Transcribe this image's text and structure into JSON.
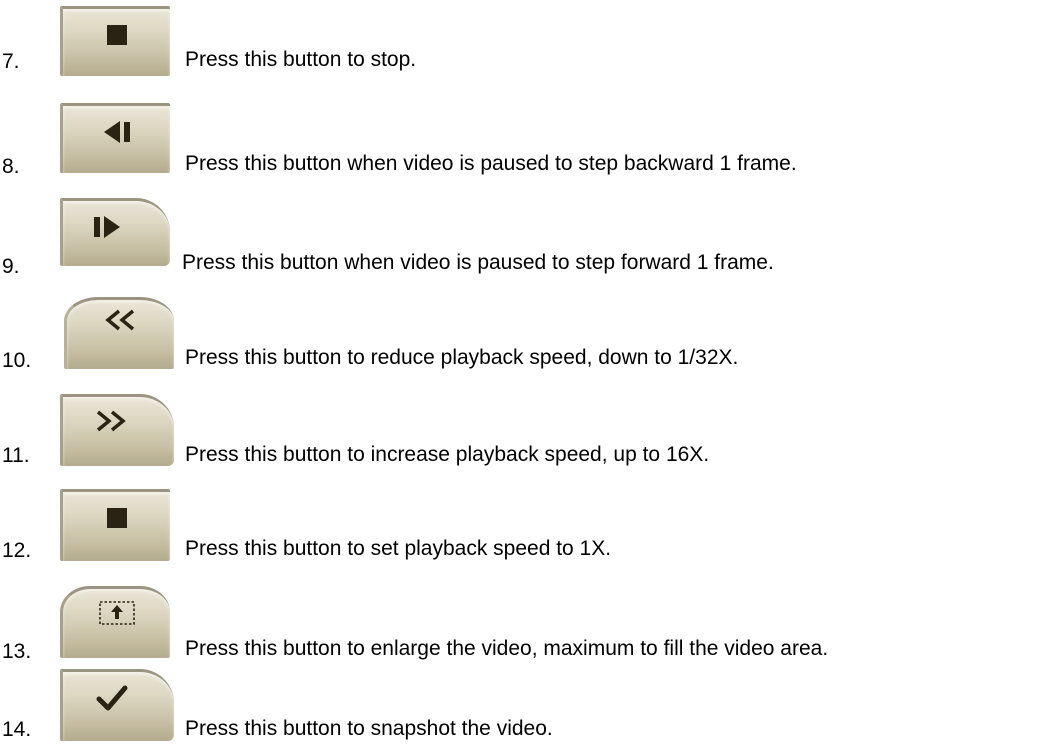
{
  "items": [
    {
      "number": "7.",
      "icon": "stop-icon",
      "text": "Press this button to stop."
    },
    {
      "number": "8.",
      "icon": "step-backward-icon",
      "text": "Press this button when video is paused to step backward 1 frame."
    },
    {
      "number": "9.",
      "icon": "step-forward-icon",
      "text": "Press this button when video is paused to step forward 1 frame."
    },
    {
      "number": "10.",
      "icon": "rewind-icon",
      "text": "Press this button to reduce playback speed, down to 1/32X."
    },
    {
      "number": "11.",
      "icon": "fast-forward-icon",
      "text": "Press this button to increase playback speed, up to 16X."
    },
    {
      "number": "12.",
      "icon": "normal-speed-icon",
      "text": "Press this button to set playback speed to 1X."
    },
    {
      "number": "13.",
      "icon": "enlarge-icon",
      "text": "Press this button to enlarge the video, maximum to fill the video area."
    },
    {
      "number": "14.",
      "icon": "snapshot-icon",
      "text": "Press this button to snapshot the video."
    }
  ],
  "colors": {
    "button_face": "#dcd6c1",
    "button_edge": "#9b9480",
    "glyph": "#2a2313"
  }
}
